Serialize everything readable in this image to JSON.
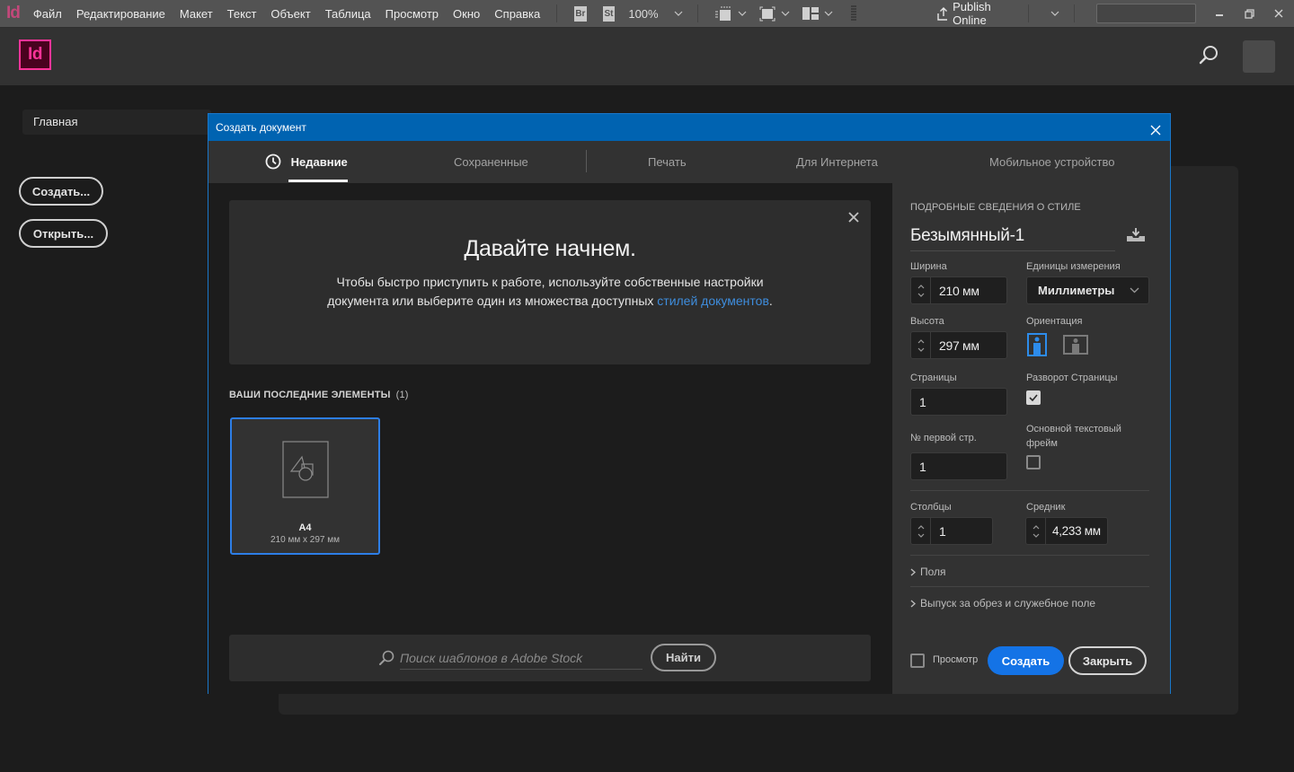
{
  "menubar": {
    "app_mark": "Id",
    "items": [
      "Файл",
      "Редактирование",
      "Макет",
      "Текст",
      "Объект",
      "Таблица",
      "Просмотр",
      "Окно",
      "Справка"
    ],
    "bridge_badge": "Br",
    "stock_badge": "St",
    "zoom_level": "100%",
    "publish_label": "Publish Online",
    "search_value": "",
    "window_controls": [
      "minimize",
      "restore",
      "close"
    ]
  },
  "header": {
    "logo": "Id",
    "search_icon": "search-icon",
    "avatar": "avatar"
  },
  "home": {
    "tab_label": "Главная",
    "create_label": "Создать...",
    "open_label": "Открыть..."
  },
  "dialog": {
    "title": "Создать документ",
    "tabs": [
      {
        "label": "Недавние",
        "active": true,
        "icon": "clock-icon"
      },
      {
        "label": "Сохраненные",
        "active": false
      },
      {
        "label": "Печать",
        "active": false
      },
      {
        "label": "Для Интернета",
        "active": false
      },
      {
        "label": "Мобильное устройство",
        "active": false
      }
    ],
    "welcome": {
      "heading": "Давайте начнем.",
      "text_before": "Чтобы быстро приступить к работе, используйте собственные настройки документа или выберите один из множества доступных ",
      "link_text": "стилей документов",
      "text_after": "."
    },
    "recent": {
      "heading": "ВАШИ ПОСЛЕДНИЕ ЭЛЕМЕНТЫ",
      "count": "(1)",
      "items": [
        {
          "name": "A4",
          "size": "210 мм x 297 мм",
          "selected": true
        }
      ]
    },
    "stock_search": {
      "placeholder": "Поиск шаблонов в Adobe Stock",
      "value": "",
      "button_label": "Найти"
    },
    "details": {
      "heading": "ПОДРОБНЫЕ СВЕДЕНИЯ О СТИЛЕ",
      "preset_name": "Безымянный-1",
      "width_label": "Ширина",
      "width_value": "210 мм",
      "units_label": "Единицы измерения",
      "units_value": "Миллиметры",
      "height_label": "Высота",
      "height_value": "297 мм",
      "orientation_label": "Ориентация",
      "orientation_value": "portrait",
      "pages_label": "Страницы",
      "pages_value": "1",
      "facing_label": "Разворот Страницы",
      "facing_checked": true,
      "start_label": "№ первой стр.",
      "start_value": "1",
      "primary_frame_label": "Основной текстовый фрейм",
      "primary_frame_checked": false,
      "columns_label": "Столбцы",
      "columns_value": "1",
      "gutter_label": "Средник",
      "gutter_value": "4,233 мм",
      "margins_label": "Поля",
      "bleed_label": "Выпуск за обрез и служебное поле",
      "preview_label": "Просмотр",
      "preview_checked": false,
      "create_label": "Создать",
      "close_label": "Закрыть"
    },
    "colors": {
      "title_bar": "#0063b1",
      "primary_button": "#1473e6",
      "link": "#3e8ddd",
      "selected_border": "#2d7ee6",
      "orientation_active": "#2d8ceb"
    }
  }
}
